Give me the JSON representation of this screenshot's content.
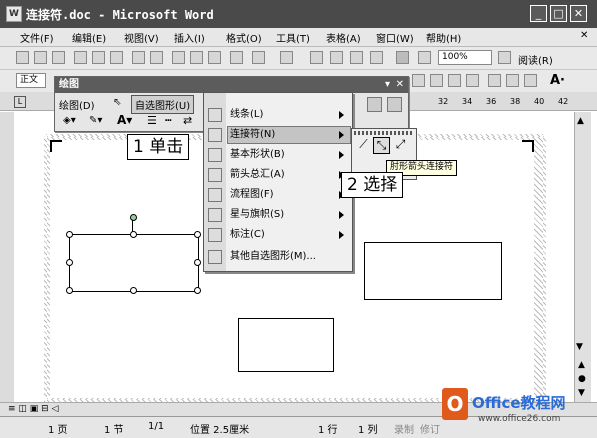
{
  "window": {
    "title": "连接符.doc - Microsoft Word",
    "icon": "word-doc-icon"
  },
  "menubar": [
    "文件(F)",
    "编辑(E)",
    "视图(V)",
    "插入(I)",
    "格式(O)",
    "工具(T)",
    "表格(A)",
    "窗口(W)",
    "帮助(H)"
  ],
  "toolbar": {
    "zoom": "100%",
    "read_label": "阅读(R)",
    "style_value": "正文"
  },
  "ruler": {
    "ticks": [
      "32",
      "34",
      "36",
      "38",
      "40",
      "42"
    ]
  },
  "drawing_toolbar": {
    "title": "绘图",
    "draw_menu": "绘图(D)",
    "autoshapes_menu": "自选图形(U)"
  },
  "autoshapes_menu": {
    "items": [
      {
        "label": "线条(L)",
        "submenu": true
      },
      {
        "label": "连接符(N)",
        "submenu": true
      },
      {
        "label": "基本形状(B)",
        "submenu": true
      },
      {
        "label": "箭头总汇(A)",
        "submenu": true
      },
      {
        "label": "流程图(F)",
        "submenu": true
      },
      {
        "label": "星与旗帜(S)",
        "submenu": true
      },
      {
        "label": "标注(C)",
        "submenu": true
      },
      {
        "label": "其他自选图形(M)...",
        "submenu": false
      }
    ]
  },
  "tooltip": "肘形箭头连接符",
  "callouts": {
    "step1": "1 单击",
    "step2": "2 选择"
  },
  "status": {
    "page": "1 页",
    "section": "1 节",
    "pages": "1/1",
    "position": "位置 2.5厘米",
    "line": "1 行",
    "column": "1 列",
    "rec": "录制",
    "rev": "修订"
  },
  "watermark": {
    "text": "Office教程网",
    "url": "www.office26.com"
  }
}
